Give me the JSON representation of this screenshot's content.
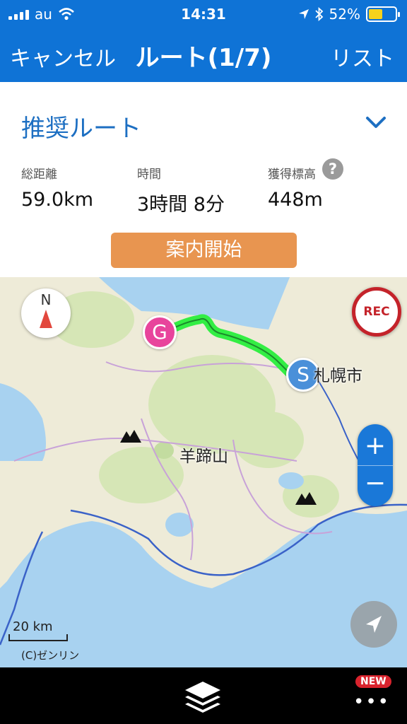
{
  "status_bar": {
    "carrier": "au",
    "time": "14:31",
    "battery": "52%",
    "battery_level": 0.52
  },
  "nav": {
    "cancel_label": "キャンセル",
    "title": "ルート(1/7)",
    "list_label": "リスト"
  },
  "route": {
    "name": "推奨ルート",
    "stats": [
      {
        "label": "総距離",
        "value": "59.0km"
      },
      {
        "label": "時間",
        "value": "3時間 8分"
      },
      {
        "label": "獲得標高",
        "value": "448m"
      }
    ],
    "help_icon": "?",
    "start_button": "案内開始"
  },
  "map": {
    "compass_label": "N",
    "rec_label": "REC",
    "goal_marker": "G",
    "start_marker": "S",
    "places": [
      {
        "name": "札幌市"
      },
      {
        "name": "羊蹄山"
      }
    ],
    "zoom_in": "+",
    "zoom_out": "−",
    "scale_label": "20 km",
    "copyright": "(C)ゼンリン",
    "route_color": "#33ee44"
  },
  "bottom_bar": {
    "new_badge": "NEW",
    "more_label": "•••"
  }
}
